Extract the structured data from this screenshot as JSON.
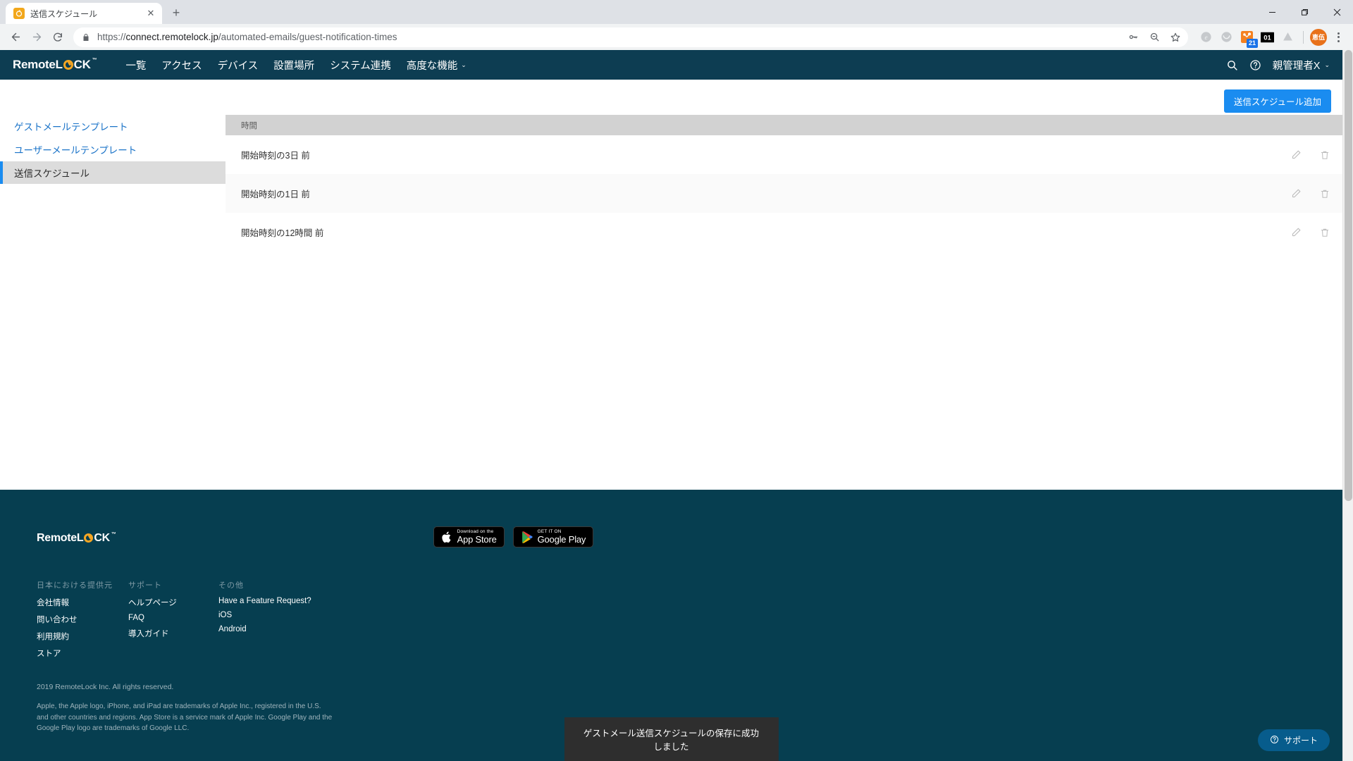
{
  "browser": {
    "tab": {
      "title": "送信スケジュール",
      "favicon": "remotelock-favicon",
      "close_label": "✕"
    },
    "newtab_label": "+",
    "window": {
      "minimize": "—",
      "maximize": "❐",
      "close": "✕"
    },
    "nav": {
      "back": "←",
      "forward": "→",
      "reload": "⟳"
    },
    "omnibox": {
      "url_secure_prefix": "https://",
      "url_domain": "connect.remotelock.jp",
      "url_path": "/automated-emails/guest-notification-times",
      "full_url": "https://connect.remotelock.jp/automated-emails/guest-notification-times",
      "lock_icon": "lock-icon"
    },
    "omni_actions": [
      "password-key-icon",
      "zoom-out-icon",
      "bookmark-star-icon"
    ],
    "extensions": [
      {
        "name": "evernote-extension-icon",
        "glyph": "e",
        "badge": ""
      },
      {
        "name": "pocket-extension-icon",
        "glyph": "",
        "badge": ""
      },
      {
        "name": "hubspot-extension-icon",
        "glyph": "",
        "badge": "21"
      },
      {
        "name": "onetab-extension-icon",
        "glyph": "01",
        "badge": ""
      },
      {
        "name": "drive-extension-icon",
        "glyph": "",
        "badge": ""
      }
    ],
    "profile": {
      "name": "avatar-button",
      "initials": "恵伍",
      "color": "#e8711a"
    },
    "menu": "chrome-menu-button"
  },
  "appnav": {
    "brand": {
      "pre": "Remote",
      "mid": "L",
      "post": "CK",
      "tm": "™",
      "accent": "#f5a623"
    },
    "links": [
      {
        "label": "一覧",
        "name": "nav-overview"
      },
      {
        "label": "アクセス",
        "name": "nav-access"
      },
      {
        "label": "デバイス",
        "name": "nav-devices"
      },
      {
        "label": "設置場所",
        "name": "nav-locations"
      },
      {
        "label": "システム連携",
        "name": "nav-integrations"
      },
      {
        "label": "高度な機能",
        "name": "nav-advanced",
        "caret": "⌄"
      }
    ],
    "search_icon": "search-icon",
    "help_icon": "help-circle-icon",
    "user": {
      "label": "親管理者X",
      "caret": "⌄"
    }
  },
  "toolbar": {
    "add_schedule_label": "送信スケジュール追加"
  },
  "sidebar": {
    "items": [
      {
        "label": "ゲストメールテンプレート",
        "name": "sidebar-item-guest-email-template",
        "active": false
      },
      {
        "label": "ユーザーメールテンプレート",
        "name": "sidebar-item-user-email-template",
        "active": false
      },
      {
        "label": "送信スケジュール",
        "name": "sidebar-item-send-schedule",
        "active": true
      }
    ]
  },
  "table": {
    "columns": [
      "時間"
    ],
    "rows": [
      {
        "time": "開始時刻の3日 前"
      },
      {
        "time": "開始時刻の1日 前"
      },
      {
        "time": "開始時刻の12時間 前"
      }
    ],
    "actions": {
      "edit_icon": "pencil-edit-icon",
      "delete_icon": "trash-delete-icon"
    }
  },
  "footer": {
    "logo": {
      "pre": "Remote",
      "mid": "L",
      "post": "CK",
      "tm": "™"
    },
    "badges": [
      {
        "name": "app-store-badge",
        "small": "Download on the",
        "big": "App Store",
        "icon": "apple-icon"
      },
      {
        "name": "google-play-badge",
        "small": "GET IT ON",
        "big": "Google Play",
        "icon": "google-play-icon"
      }
    ],
    "columns": [
      {
        "heading": "日本における提供元",
        "links": [
          "会社情報",
          "問い合わせ",
          "利用規約",
          "ストア"
        ]
      },
      {
        "heading": "サポート",
        "links": [
          "ヘルプページ",
          "FAQ",
          "導入ガイド"
        ]
      },
      {
        "heading": "その他",
        "links": [
          "Have a Feature Request?",
          "iOS",
          "Android"
        ]
      }
    ],
    "copyright": "2019 RemoteLock Inc. All rights reserved.",
    "legal": "Apple, the Apple logo, iPhone, and iPad are trademarks of Apple Inc., registered in the U.S. and other countries and regions. App Store is a service mark of Apple Inc. Google Play and the Google Play logo are trademarks of Google LLC."
  },
  "toast": {
    "message": "ゲストメール送信スケジュールの保存に成功しました"
  },
  "support": {
    "label": "サポート",
    "icon": "help-circle-icon"
  },
  "colors": {
    "nav_bg": "#0d3d52",
    "footer_bg": "#063e50",
    "accent_blue": "#1a8cf0",
    "link_blue": "#1a73c8",
    "brand_orange": "#f5a623",
    "toast_bg": "#2e2e2e",
    "support_bg": "#075c8c"
  }
}
